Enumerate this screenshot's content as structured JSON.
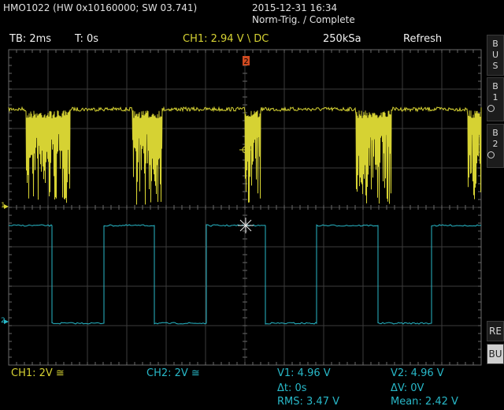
{
  "header": {
    "device": "HMO1022 (HW 0x10160000; SW 03.741)",
    "datetime": "2015-12-31 16:34",
    "status": "Norm-Trig. / Complete"
  },
  "topbar": {
    "timebase": "TB: 2ms",
    "trigger_time": "T: 0s",
    "ch1_trigger": "CH1: 2.94 V \\ DC",
    "sample_rate": "250kSa",
    "mode": "Refresh"
  },
  "markers": {
    "trigger_marker": "2",
    "ch1_marker": "1",
    "ch2_marker": "2",
    "trig_right": "T"
  },
  "sidebar": {
    "bus_letters": [
      "B",
      "U",
      "S"
    ],
    "b1_letters": [
      "B",
      "1"
    ],
    "b2_letters": [
      "B",
      "2"
    ],
    "re_label": "RE",
    "bu_label": "BU"
  },
  "bottom": {
    "ch1_scale": "CH1: 2V ≅",
    "ch2_scale": "CH2: 2V ≅",
    "v1": "V1: 4.96 V",
    "v2": "V2: 4.96 V",
    "dt": "Δt: 0s",
    "dv": "ΔV: 0V",
    "rms": "RMS: 3.47 V",
    "mean": "Mean: 2.42 V"
  },
  "colors": {
    "ch1": "#d6d233",
    "ch2": "#28b8c8",
    "grid": "#3c3c3c"
  }
}
